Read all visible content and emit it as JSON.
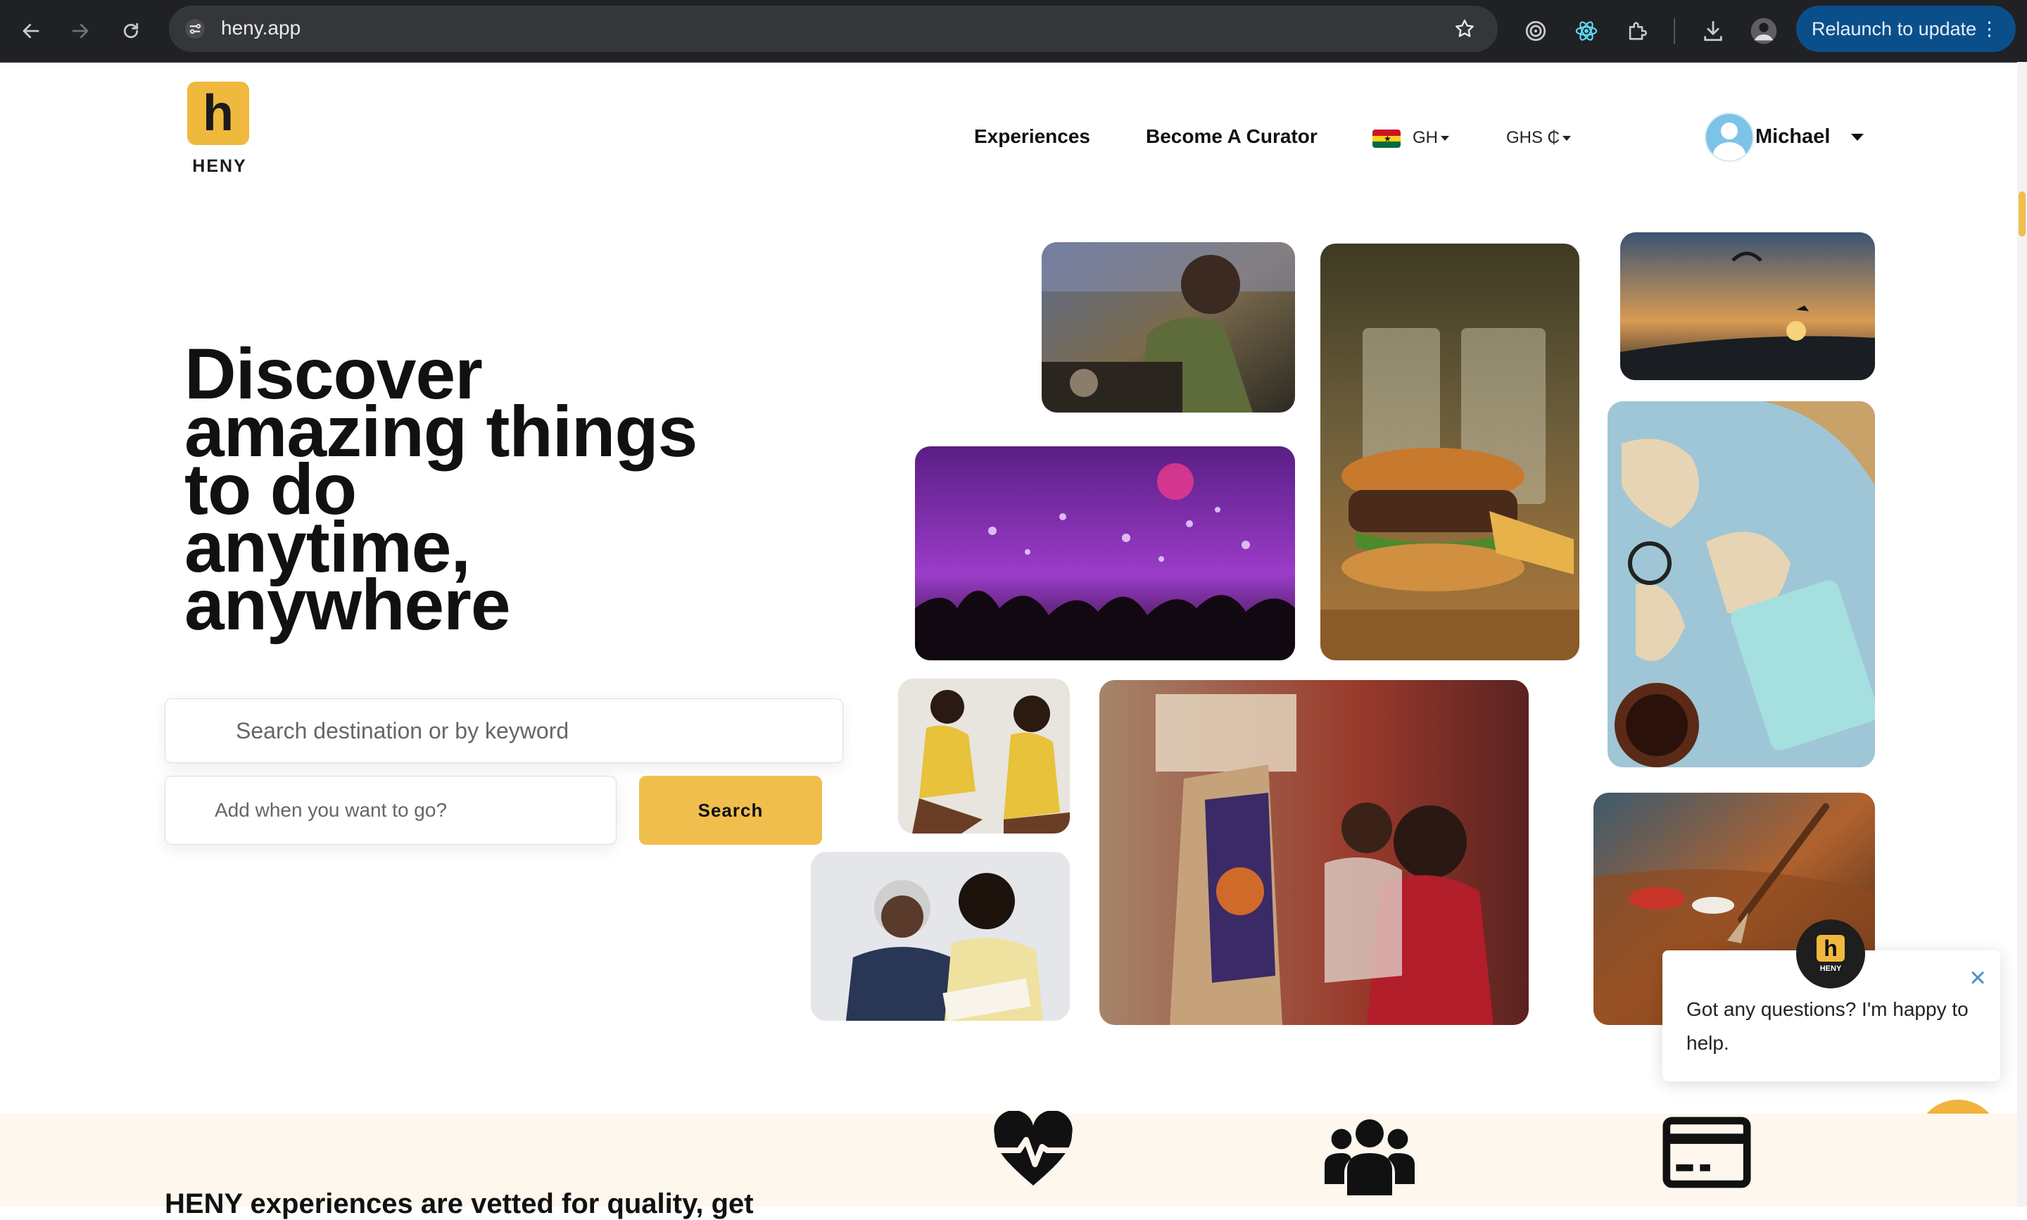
{
  "browser": {
    "url": "heny.app",
    "relaunch_label": "Relaunch to update"
  },
  "header": {
    "logo_letter": "h",
    "logo_text": "HENY",
    "nav": {
      "experiences": "Experiences",
      "curator": "Become A Curator"
    },
    "country": "GH",
    "currency": "GHS ₵",
    "user_name": "Michael"
  },
  "hero": {
    "title_lines": [
      "Discover",
      "amazing things",
      "to do",
      "anytime,",
      "anywhere"
    ],
    "search_placeholder": "Search destination or by keyword",
    "date_placeholder": "Add when you want to go?",
    "search_button": "Search"
  },
  "chat": {
    "avatar_letter": "h",
    "avatar_text": "HENY",
    "message": "Got any questions? I'm happy to help."
  },
  "bottom": {
    "text": "HENY experiences are vetted for quality, get"
  },
  "colors": {
    "brand_yellow": "#efb93d",
    "chrome_bg": "#202124",
    "relaunch_blue": "#0b4f8a"
  }
}
